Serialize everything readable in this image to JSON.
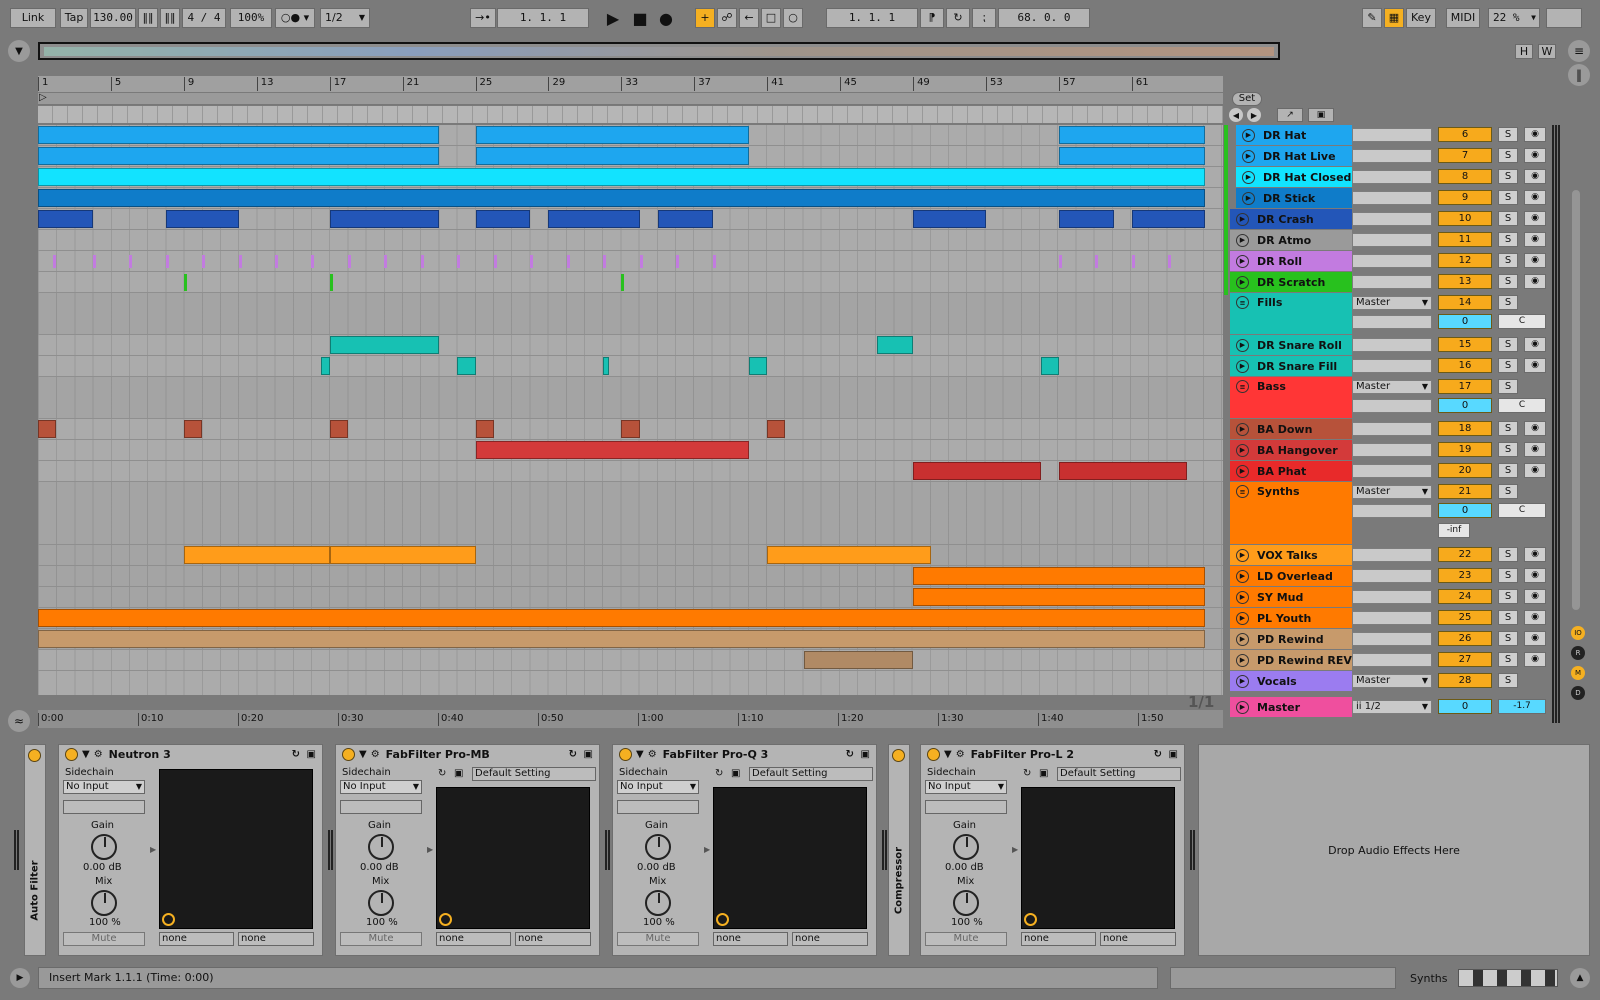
{
  "toolbar": {
    "link": "Link",
    "tap": "Tap",
    "tempo": "130.00",
    "signature": "4 / 4",
    "zoom": "100%",
    "quantize": "1/2",
    "arrangement_position": "1.  1.  1",
    "loop_start": "1.  1.  1",
    "loop_length": "68.  0.  0",
    "key": "Key",
    "midi": "MIDI",
    "cpu": "22 %"
  },
  "overview": {
    "h_label": "H",
    "w_label": "W"
  },
  "ruler": {
    "bars": [
      "1",
      "5",
      "9",
      "13",
      "17",
      "21",
      "25",
      "29",
      "33",
      "37",
      "41",
      "45",
      "49",
      "53",
      "57",
      "61"
    ],
    "time": [
      "0:00",
      "0:10",
      "0:20",
      "0:30",
      "0:40",
      "0:50",
      "1:00",
      "1:10",
      "1:20",
      "1:30",
      "1:40",
      "1:50"
    ],
    "set_label": "Set",
    "page": "1/1"
  },
  "tracks": [
    {
      "name": "DR Hat",
      "color": "#1ea6ef",
      "number": "6",
      "solo": "S",
      "indent": true
    },
    {
      "name": "DR Hat Live",
      "color": "#1ea6ef",
      "number": "7",
      "solo": "S",
      "indent": true
    },
    {
      "name": "DR Hat Closed",
      "color": "#12e3ff",
      "number": "8",
      "solo": "S",
      "indent": true
    },
    {
      "name": "DR Stick",
      "color": "#0f7cc9",
      "number": "9",
      "solo": "S",
      "indent": true
    },
    {
      "name": "DR Crash",
      "color": "#2356b8",
      "number": "10",
      "solo": "S",
      "indent": false
    },
    {
      "name": "DR Atmo",
      "color": "#9a9a9a",
      "number": "11",
      "solo": "S",
      "indent": false
    },
    {
      "name": "DR Roll",
      "color": "#c27be0",
      "number": "12",
      "solo": "S",
      "indent": false
    },
    {
      "name": "DR Scratch",
      "color": "#28c11e",
      "number": "13",
      "solo": "S",
      "indent": false
    },
    {
      "name": "Fills",
      "color": "#17c1b3",
      "number": "14",
      "solo": "S",
      "group": true,
      "output": "Master",
      "pan": "0",
      "center": "C"
    },
    {
      "name": "DR Snare Roll",
      "color": "#17c1b3",
      "number": "15",
      "solo": "S",
      "indent": false
    },
    {
      "name": "DR Snare Fill",
      "color": "#17c1b3",
      "number": "16",
      "solo": "S",
      "indent": false
    },
    {
      "name": "Bass",
      "color": "#ff3636",
      "number": "17",
      "solo": "S",
      "group": true,
      "output": "Master",
      "pan": "0",
      "center": "C"
    },
    {
      "name": "BA Down",
      "color": "#b7523a",
      "number": "18",
      "solo": "S",
      "indent": false
    },
    {
      "name": "BA Hangover",
      "color": "#d33a3a",
      "number": "19",
      "solo": "S",
      "indent": false
    },
    {
      "name": "BA Phat",
      "color": "#e82a2a",
      "number": "20",
      "solo": "S",
      "indent": false
    },
    {
      "name": "Synths",
      "color": "#ff7a00",
      "number": "21",
      "solo": "S",
      "group": true,
      "output": "Master",
      "pan": "0",
      "center": "C",
      "volume": "-inf"
    },
    {
      "name": "VOX Talks",
      "color": "#ff9c1a",
      "number": "22",
      "solo": "S",
      "indent": false
    },
    {
      "name": "LD Overlead",
      "color": "#ff7a00",
      "number": "23",
      "solo": "S",
      "indent": false
    },
    {
      "name": "SY Mud",
      "color": "#ff7a00",
      "number": "24",
      "solo": "S",
      "indent": false
    },
    {
      "name": "PL Youth",
      "color": "#ff7a00",
      "number": "25",
      "solo": "S",
      "indent": false
    },
    {
      "name": "PD Rewind",
      "color": "#c79a6b",
      "number": "26",
      "solo": "S",
      "indent": false
    },
    {
      "name": "PD Rewind REV",
      "color": "#c79a6b",
      "number": "27",
      "solo": "S",
      "indent": false
    },
    {
      "name": "Vocals",
      "color": "#9b7cf0",
      "number": "28",
      "solo": "S",
      "output": "Master"
    },
    {
      "name": "Master",
      "color": "#ef4f9e",
      "output": "ii 1/2",
      "pan": "0",
      "volume": "-1.7"
    }
  ],
  "devices": {
    "auto_filter": "Auto Filter",
    "compressor": "Compressor",
    "plugins": [
      {
        "name": "Neutron 3",
        "sidechain": "Sidechain",
        "input": "No Input",
        "gain_label": "Gain",
        "gain": "0.00 dB",
        "mix_label": "Mix",
        "mix": "100 %",
        "mute": "Mute",
        "preset": "",
        "out_a": "none",
        "out_b": "none"
      },
      {
        "name": "FabFilter Pro-MB",
        "sidechain": "Sidechain",
        "input": "No Input",
        "gain_label": "Gain",
        "gain": "0.00 dB",
        "mix_label": "Mix",
        "mix": "100 %",
        "mute": "Mute",
        "preset": "Default Setting",
        "out_a": "none",
        "out_b": "none"
      },
      {
        "name": "FabFilter Pro-Q 3",
        "sidechain": "Sidechain",
        "input": "No Input",
        "gain_label": "Gain",
        "gain": "0.00 dB",
        "mix_label": "Mix",
        "mix": "100 %",
        "mute": "Mute",
        "preset": "Default Setting",
        "out_a": "none",
        "out_b": "none"
      },
      {
        "name": "FabFilter Pro-L 2",
        "sidechain": "Sidechain",
        "input": "No Input",
        "gain_label": "Gain",
        "gain": "0.00 dB",
        "mix_label": "Mix",
        "mix": "100 %",
        "mute": "Mute",
        "preset": "Default Setting",
        "out_a": "none",
        "out_b": "none"
      }
    ],
    "drop_zone": "Drop Audio Effects Here"
  },
  "status": {
    "message": "Insert Mark 1.1.1 (Time: 0:00)",
    "track": "Synths"
  }
}
